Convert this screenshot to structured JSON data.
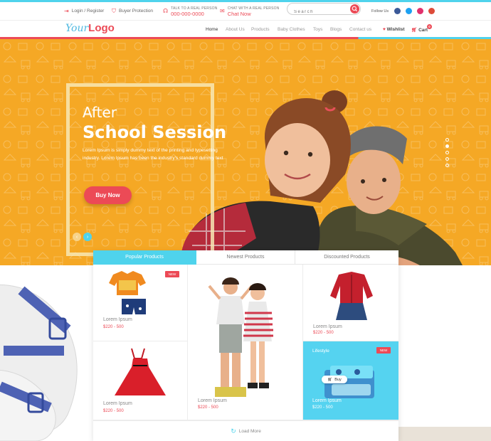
{
  "topbar": {
    "login_label": "Login / Register",
    "protection_label": "Buyer Protection",
    "talk_small": "TALK TO A REAL PERSON",
    "talk_phone": "000-000-0000",
    "chat_small": "CHAT WITH A REAL PERSON",
    "chat_big": "Chat Now",
    "search_placeholder": "Search",
    "follow_label": "Follow Us",
    "social": [
      {
        "name": "facebook-icon",
        "color": "#3b5998"
      },
      {
        "name": "twitter-icon",
        "color": "#1da1f2"
      },
      {
        "name": "instagram-icon",
        "color": "#e1306c"
      },
      {
        "name": "googleplus-icon",
        "color": "#dd4b39"
      }
    ]
  },
  "nav": {
    "logo_your": "Your",
    "logo_logo": "Logo",
    "items": [
      "Home",
      "About Us",
      "Products",
      "Baby Clothes",
      "Toys",
      "Blogs",
      "Contact us"
    ],
    "wishlist": "Wishlist",
    "cart": "Cart",
    "cart_count": "0"
  },
  "hero": {
    "pre_title": "After",
    "title": "School Session",
    "description": "Lorem Ipsum is simply dummy text of the printing and typesetting industry. Lorem Ipsum has been the industry's standard dummy text",
    "cta": "Buy Now"
  },
  "tabs": [
    "Popular Products",
    "Newest Products",
    "Discounted Products"
  ],
  "products": [
    {
      "name": "Lorem Ipsum",
      "price": "$220 - 500",
      "badge": "NEW"
    },
    {
      "name": "Lorem Ipsum",
      "price": "$220 - 500"
    },
    {
      "name": "Lorem Ipsum",
      "price": "$220 - 500"
    },
    {
      "name": "Lorem Ipsum",
      "price": "$220 - 500"
    },
    {
      "name": "Lorem Ipsum",
      "price": "$220 - 500",
      "badge": "NEW",
      "tag": "Lifestyle",
      "buy": "Buy"
    }
  ],
  "load_more": "Load More",
  "colors": {
    "accent": "#4fd3ec",
    "brand": "#ec4a56",
    "hero": "#f5a825"
  }
}
